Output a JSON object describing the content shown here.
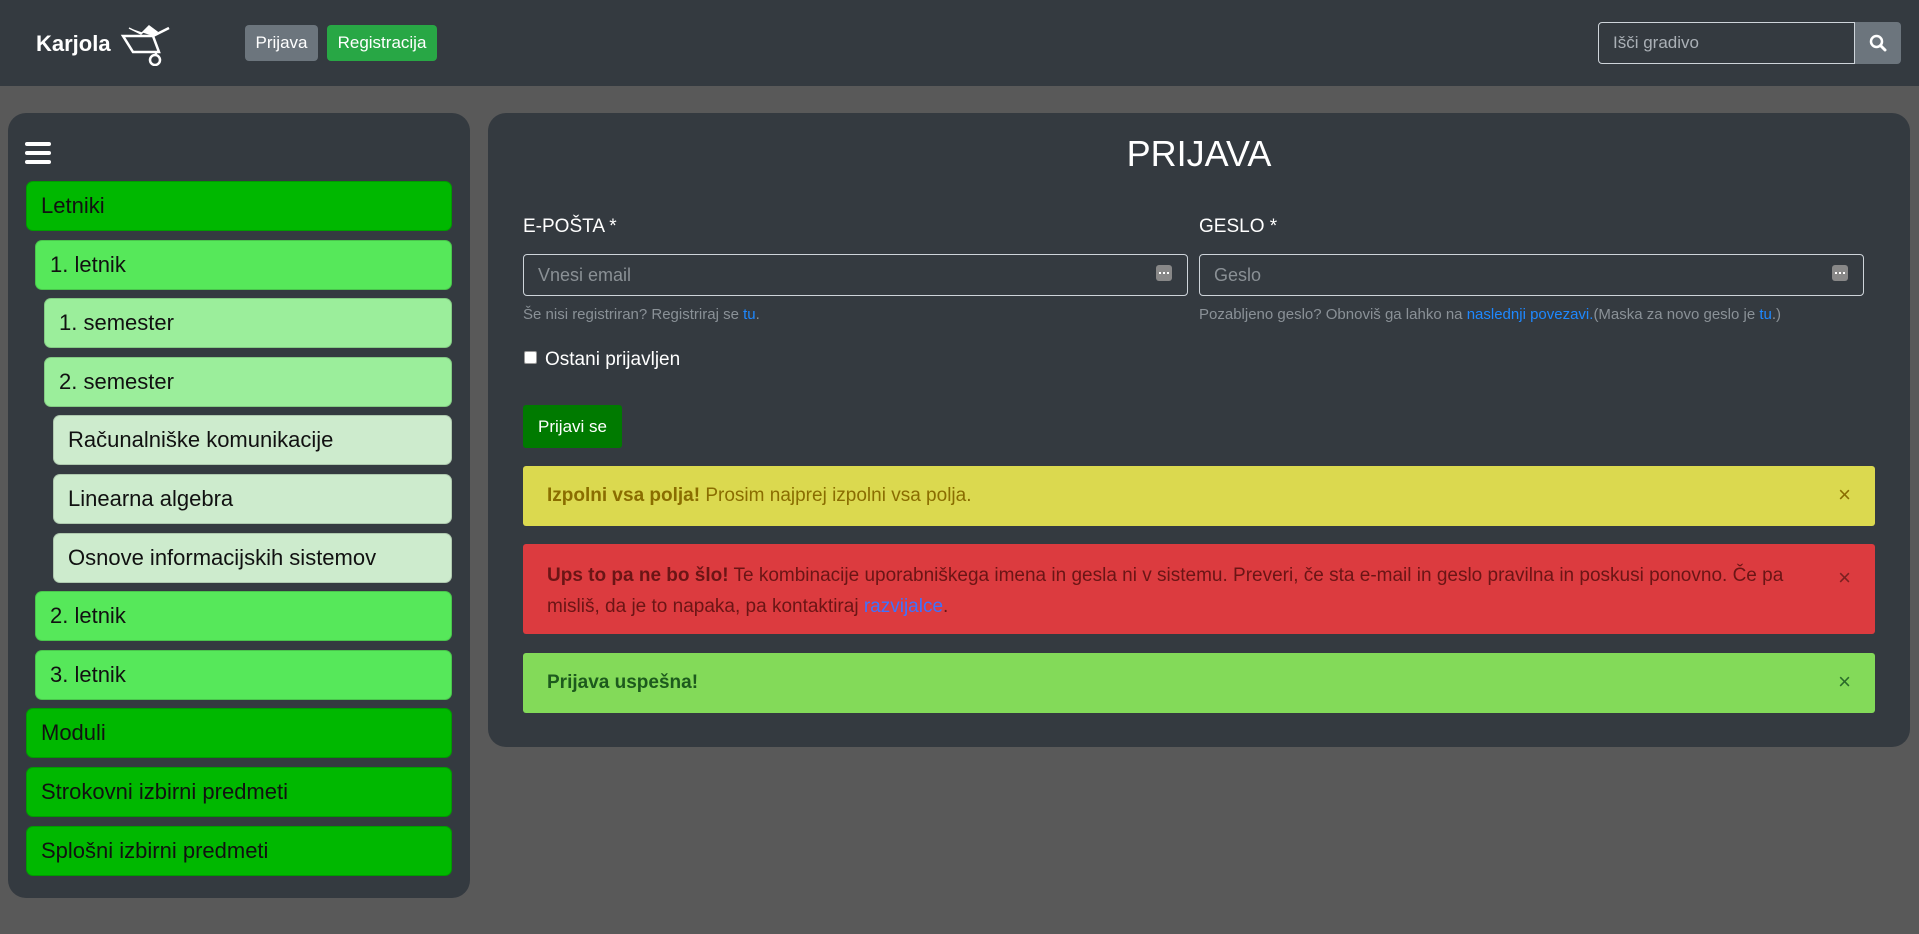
{
  "navbar": {
    "brand": "Karjola",
    "login_label": "Prijava",
    "register_label": "Registracija",
    "search_placeholder": "Išči gradivo"
  },
  "sidebar": {
    "items": [
      {
        "label": "Letniki"
      },
      {
        "label": "1. letnik"
      },
      {
        "label": "1. semester"
      },
      {
        "label": "2. semester"
      },
      {
        "label": "Računalniške komunikacije"
      },
      {
        "label": "Linearna algebra"
      },
      {
        "label": "Osnove informacijskih sistemov"
      },
      {
        "label": "2. letnik"
      },
      {
        "label": "3. letnik"
      },
      {
        "label": "Moduli"
      },
      {
        "label": "Strokovni izbirni predmeti"
      },
      {
        "label": "Splošni izbirni predmeti"
      }
    ]
  },
  "form": {
    "title": "PRIJAVA",
    "email_label": "E-POŠTA *",
    "email_placeholder": "Vnesi email",
    "email_hint_text": "Še nisi registriran? Registriraj se ",
    "email_hint_link": "tu",
    "email_hint_end": ".",
    "password_label": "GESLO *",
    "password_placeholder": "Geslo",
    "password_hint_text": "Pozabljeno geslo? Obnoviš ga lahko na ",
    "password_hint_link": "naslednji povezavi.",
    "password_hint_mid": "(Maska za novo geslo je ",
    "password_hint_link2": "tu",
    "password_hint_end": ".)",
    "remember_label": "Ostani prijavljen",
    "submit_label": "Prijavi se"
  },
  "alerts": {
    "warning_bold": "Izpolni vsa polja!",
    "warning_text": " Prosim najprej izpolni vsa polja.",
    "error_bold": "Ups to pa ne bo šlo!",
    "error_text": " Te kombinacije uporabniškega imena in gesla ni v sistemu. Preveri, če sta e-mail in geslo pravilna in poskusi ponovno. Če pa misliš, da je to napaka, pa kontaktiraj ",
    "error_link": "razvijalce",
    "error_end": ".",
    "success_bold": "Prijava uspešna!",
    "close_symbol": "×"
  }
}
